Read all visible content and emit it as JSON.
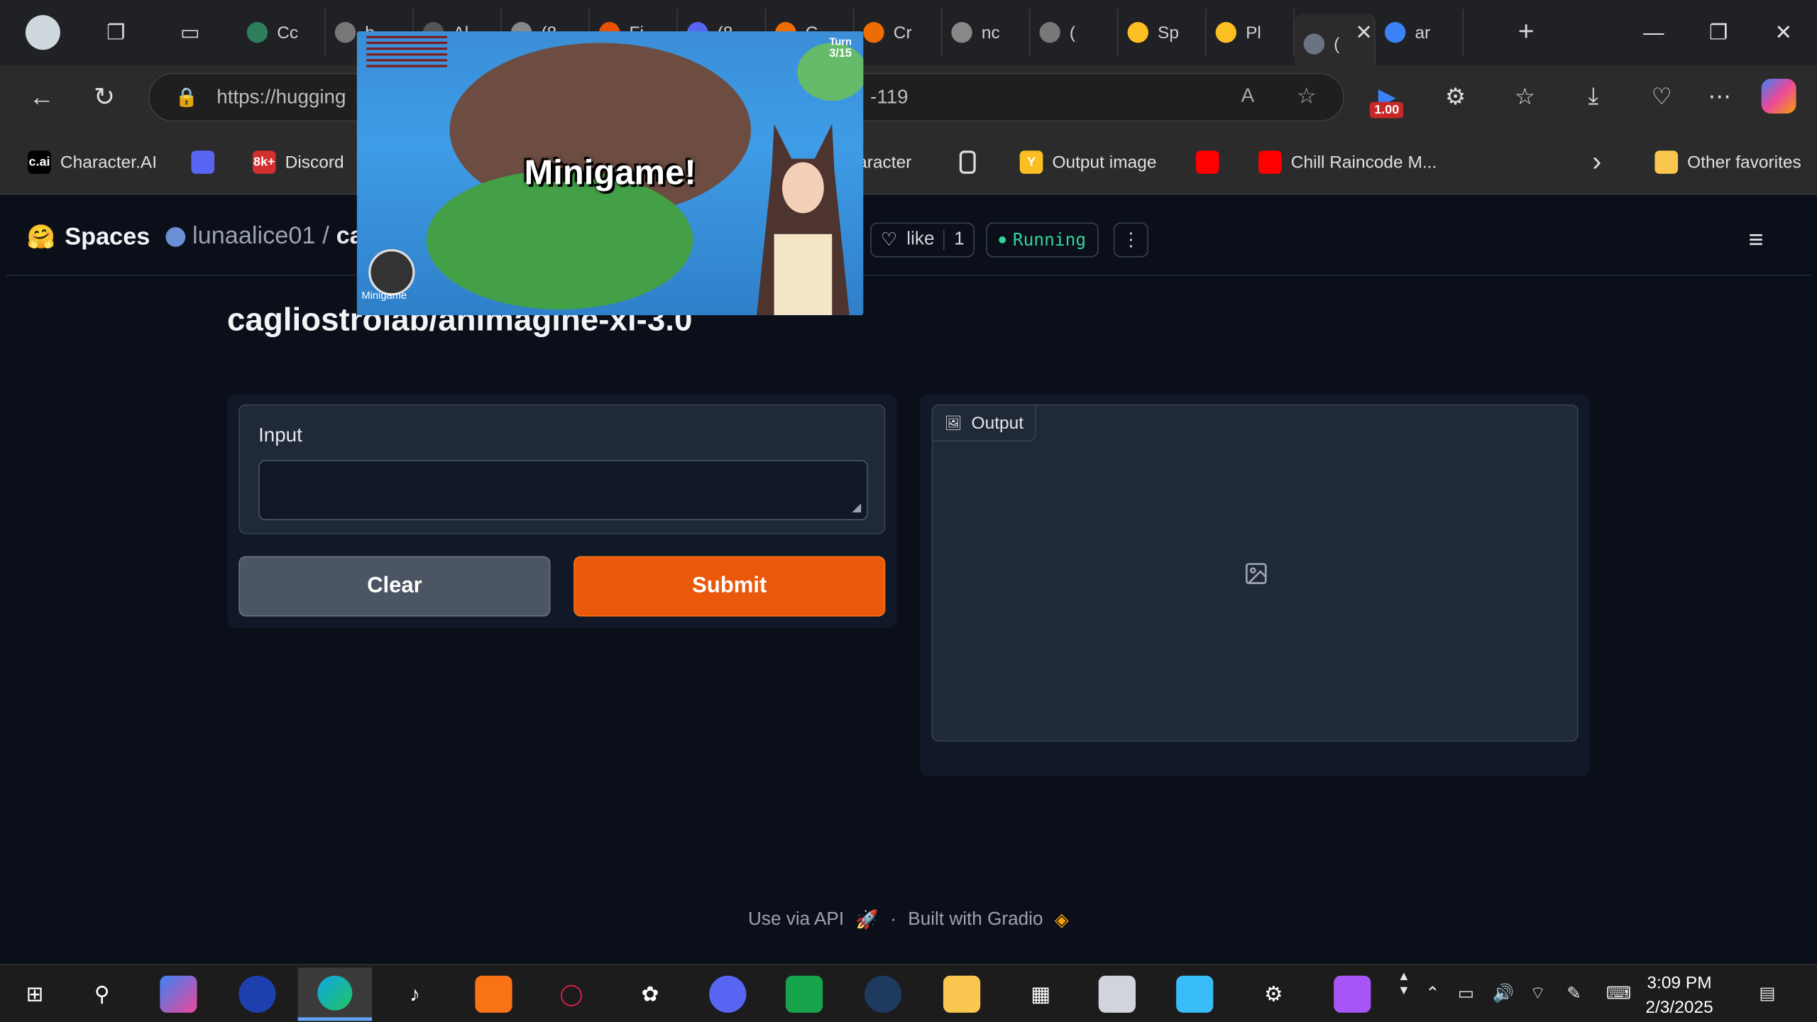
{
  "browser": {
    "tabs": [
      {
        "label": "Cc",
        "color": "#2e7d5b"
      },
      {
        "label": "b",
        "color": "#777777"
      },
      {
        "label": "Al",
        "color": "#555555"
      },
      {
        "label": "(8",
        "color": "#888888"
      },
      {
        "label": "Fi",
        "color": "#e65100"
      },
      {
        "label": "(8",
        "color": "#5865f2"
      },
      {
        "label": "C",
        "color": "#ef6c00"
      },
      {
        "label": "Cr",
        "color": "#ef6c00"
      },
      {
        "label": "nc",
        "color": "#888888"
      },
      {
        "label": "(",
        "color": "#777777"
      },
      {
        "label": "Sp",
        "color": "#fbbf24"
      },
      {
        "label": "Pl",
        "color": "#fbbf24"
      },
      {
        "label": "(",
        "color": "#6b7280"
      },
      {
        "label": "ar",
        "color": "#3b82f6"
      }
    ],
    "url_start": "https://hugging",
    "url_end": "-119",
    "extension_badge": "1.00",
    "favorites": [
      {
        "label": "Character.AI",
        "icon": "c.ai",
        "color": "#000000"
      },
      {
        "label": "",
        "icon": "discord-icon",
        "color": "#5865f2"
      },
      {
        "label": "Discord",
        "icon": "8k+",
        "color": "#d32f2f"
      },
      {
        "label": "aracter",
        "icon": "",
        "color": ""
      },
      {
        "label": "",
        "icon": "page-icon",
        "color": ""
      },
      {
        "label": "Output image",
        "icon": "Y",
        "color": "#fbbf24"
      },
      {
        "label": "",
        "icon": "youtube-icon",
        "color": "#ff0000"
      },
      {
        "label": "Chill Raincode M...",
        "icon": "youtube-icon",
        "color": "#ff0000"
      },
      {
        "label": "Other favorites",
        "icon": "folder-icon",
        "color": "#f9c74f"
      }
    ]
  },
  "header": {
    "spaces": "Spaces",
    "owner": "lunaalice01",
    "repo_partial": "ca",
    "like": "like",
    "like_count": "1",
    "status": "Running"
  },
  "app": {
    "title": "cagliostrolab/animagine-xl-3.0",
    "input_label": "Input",
    "input_value": "",
    "clear_label": "Clear",
    "submit_label": "Submit",
    "output_label": "Output"
  },
  "footer": {
    "api": "Use via API",
    "separator": "·",
    "built": "Built with Gradio"
  },
  "overlay": {
    "title": "Minigame!",
    "logo_text": "Minigame",
    "turn_label": "Turn",
    "turn_value": "3/15"
  },
  "taskbar": {
    "time": "3:09 PM",
    "date": "2/3/2025"
  }
}
